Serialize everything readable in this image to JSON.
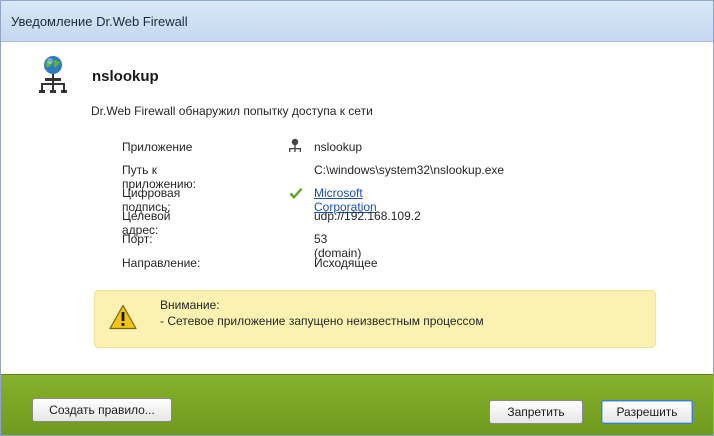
{
  "window": {
    "title": "Уведомление Dr.Web Firewall"
  },
  "header": {
    "app_name": "nslookup",
    "subtitle": "Dr.Web Firewall обнаружил попытку доступа к сети"
  },
  "details": [
    {
      "label": "Приложение",
      "value": "nslookup",
      "icon": "network-app-icon"
    },
    {
      "label": "Путь к приложению:",
      "value": "C:\\windows\\system32\\nslookup.exe"
    },
    {
      "label": "Цифровая подпись:",
      "value": "Microsoft Corporation",
      "icon": "checkmark-icon"
    },
    {
      "label": "Целевой адрес:",
      "value": "udp://192.168.109.2"
    },
    {
      "label": "Порт:",
      "value": "53 (domain)"
    },
    {
      "label": "Направление:",
      "value": "Исходящее"
    }
  ],
  "warning": {
    "icon": "warning-triangle-icon",
    "title": "Внимание:",
    "text": "- Сетевое приложение запущено неизвестным процессом"
  },
  "footer": {
    "create_rule_label": "Создать правило...",
    "deny_label": "Запретить",
    "allow_label": "Разрешить"
  },
  "colors": {
    "footer_green": "#7ea825",
    "warning_bg": "#fbf2b2",
    "link": "#1d4fb5",
    "check_green": "#5aa62a"
  }
}
